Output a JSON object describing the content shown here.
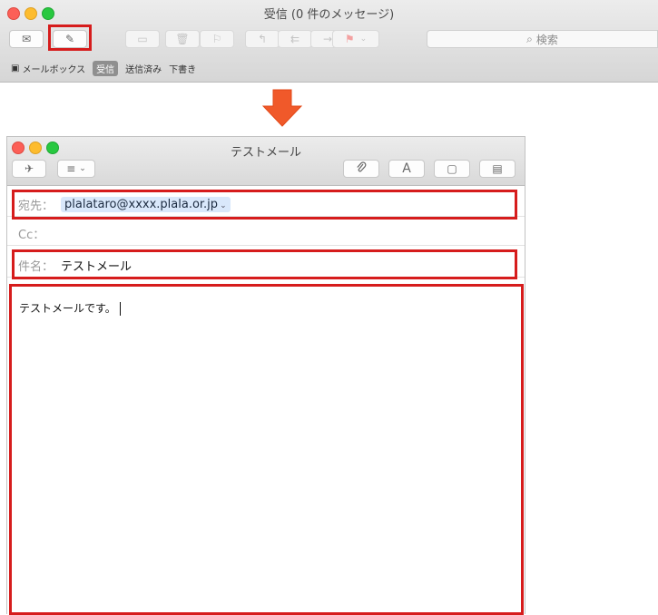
{
  "mail_window": {
    "title": "受信 (0 件のメッセージ)",
    "search_placeholder": "検索",
    "favorites": {
      "mailboxes": "メールボックス",
      "inbox": "受信",
      "sent": "送信済み",
      "drafts": "下書き"
    }
  },
  "compose_window": {
    "title": "テストメール",
    "to_label": "宛先：",
    "to_value": "plalataro@xxxx.plala.or.jp",
    "cc_label": "Cc：",
    "subject_label": "件名：",
    "subject_value": "テストメール",
    "body_text": "テストメールです。"
  },
  "icons": {
    "get_mail": "✉",
    "compose": "✎",
    "archive": "▭",
    "trash": "🗑",
    "junk": "⚐",
    "reply": "↰",
    "reply_all": "⇇",
    "forward": "→",
    "flag": "⚑",
    "send": "✈",
    "header_fields": "≡",
    "attach": "📎",
    "format": "A",
    "photo": "▢",
    "template": "▤"
  },
  "colors": {
    "highlight": "#d61c1c",
    "arrow": "#f0592a",
    "token_bg": "#d9e8fb"
  }
}
